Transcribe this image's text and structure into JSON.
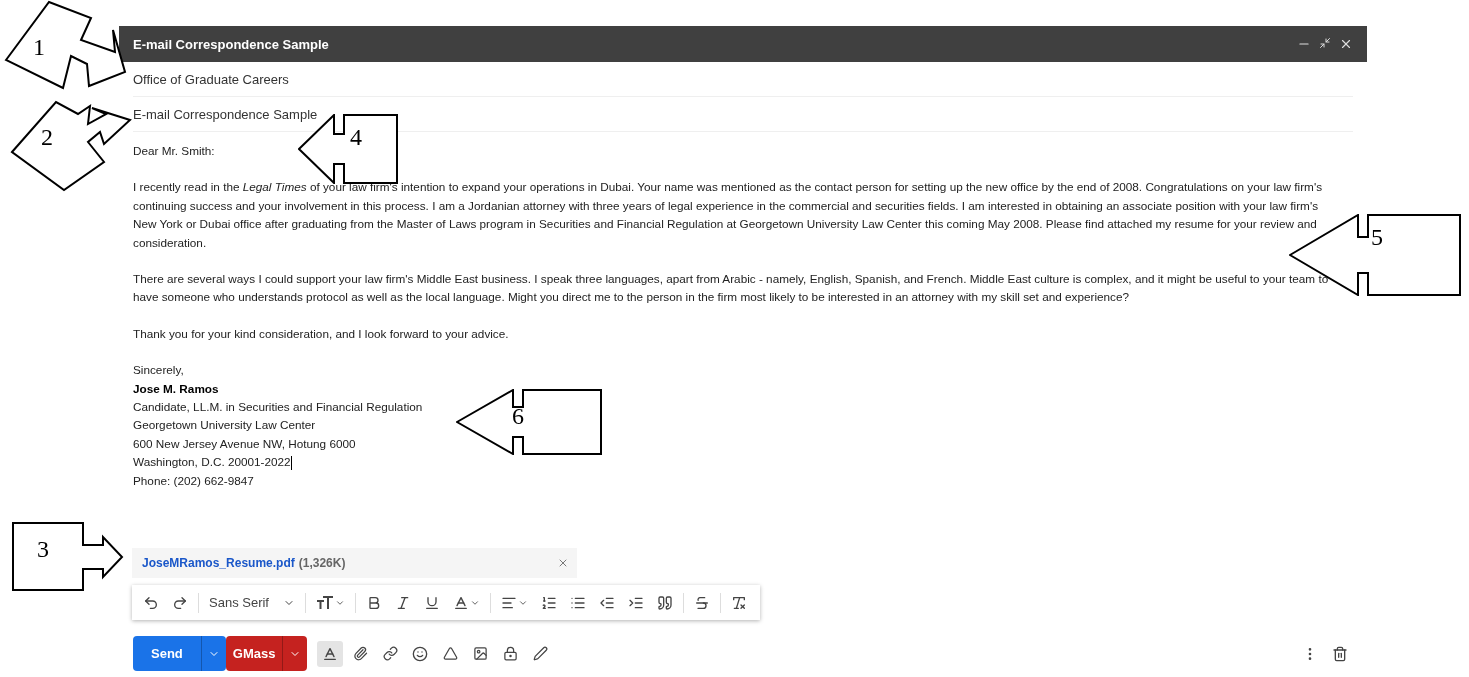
{
  "window": {
    "title": "E-mail Correspondence Sample"
  },
  "recipient": "Office of Graduate Careers",
  "subject": "E-mail Correspondence Sample",
  "greeting": "Dear Mr. Smith:",
  "paragraphs": [
    "I recently read in the *Legal Times* of your law firm's intention to expand your operations in Dubai. Your name was mentioned as the contact person for setting up the new office by the end of 2008. Congratulations on your law firm's continuing success and your involvement in this process. I am a Jordanian attorney with three years of legal experience in the commercial and securities fields. I am interested in obtaining an associate position with your law firm's New York or Dubai office after graduating from the Master of Laws program in Securities and Financial Regulation at Georgetown University Law Center this coming May 2008. Please find attached my resume for your review and consideration.",
    "There are several ways I could support your law firm's Middle East business. I speak three languages, apart from Arabic - namely, English, Spanish, and French. Middle East culture is complex, and it might be useful to your team to have someone who understands protocol as well as the local language. Might you direct me to the person in the firm most likely to be interested in an attorney with my skill set and experience?",
    "Thank you for your kind consideration, and I look forward to your advice."
  ],
  "signature": {
    "closing": "Sincerely,",
    "name": "Jose M. Ramos",
    "lines": [
      "Candidate, LL.M. in Securities and Financial Regulation",
      "Georgetown University Law Center",
      "600 New Jersey Avenue NW, Hotung 6000",
      "Washington, D.C. 20001-2022",
      "Phone: (202) 662-9847"
    ]
  },
  "attachment": {
    "name": "JoseMRamos_Resume.pdf",
    "size": "(1,326K)"
  },
  "format_toolbar": {
    "font": "Sans Serif"
  },
  "bottom_bar": {
    "send": "Send",
    "gmass": "GMass",
    "formatting_selected": true
  },
  "callouts": [
    {
      "number": "1",
      "kind": "tilted-right"
    },
    {
      "number": "2",
      "kind": "tilted-up"
    },
    {
      "number": "3",
      "kind": "right"
    },
    {
      "number": "4",
      "kind": "left"
    },
    {
      "number": "5",
      "kind": "left"
    },
    {
      "number": "6",
      "kind": "left"
    }
  ]
}
